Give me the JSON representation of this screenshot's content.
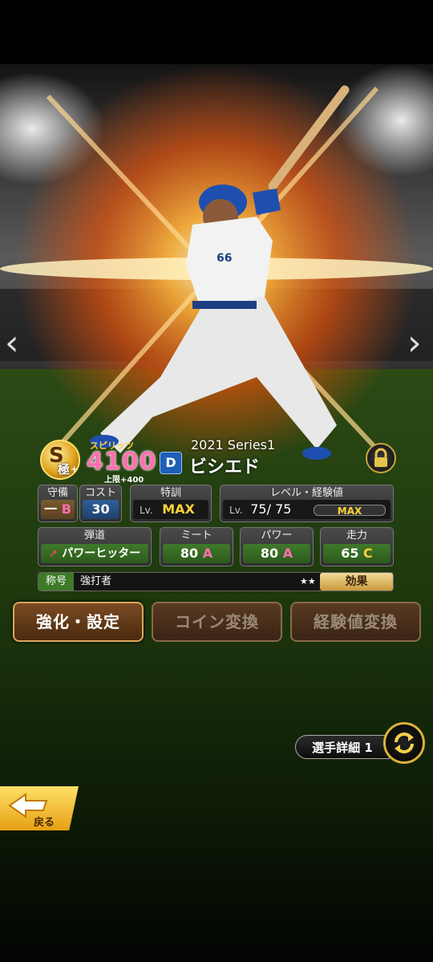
{
  "player": {
    "rank_letter": "S",
    "rank_sub": "極",
    "rank_plus": "+",
    "spirits_label": "スピリッツ",
    "spirits_value": "4100",
    "spirits_cap": "上限+400",
    "series": "2021 Series1",
    "name": "ビシエド",
    "team_logo": "D",
    "uniform_number": "66"
  },
  "stats": {
    "position_label": "守備",
    "position_value": "一",
    "position_grade": "B",
    "cost_label": "コスト",
    "cost_value": "30",
    "training_label": "特訓",
    "training_lv": "Lv.",
    "training_value": "MAX",
    "level_label": "レベル・経験値",
    "level_lv": "Lv.",
    "level_value": "75/ 75",
    "level_bar": "MAX",
    "trajectory_label": "弾道",
    "trajectory_value": "パワーヒッター",
    "meet_label": "ミート",
    "meet_value": "80",
    "meet_grade": "A",
    "power_label": "パワー",
    "power_value": "80",
    "power_grade": "A",
    "speed_label": "走力",
    "speed_value": "65",
    "speed_grade": "C",
    "title_label": "称号",
    "title_value": "強打者",
    "title_stars": "★★",
    "effect_label": "効果"
  },
  "buttons": {
    "enhance": "強化・設定",
    "coin": "コイン変換",
    "exp": "経験値変換"
  },
  "detail": {
    "label": "選手詳細 1"
  },
  "back": {
    "label": "戻る"
  },
  "nav": {
    "prev": "‹",
    "next": "›"
  },
  "colors": {
    "accent_gold": "#ffd23a",
    "grade_pink": "#ff6fae",
    "team_blue": "#1f5fb8"
  }
}
